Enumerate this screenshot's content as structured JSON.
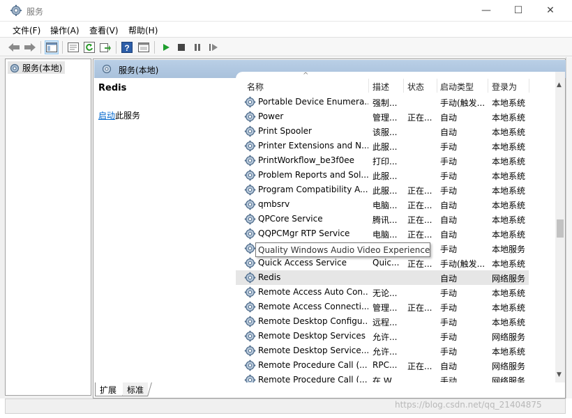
{
  "window": {
    "title": "服务",
    "min_glyph": "—",
    "max_glyph": "☐",
    "close_glyph": "✕"
  },
  "menu": [
    {
      "label": "文件(F)"
    },
    {
      "label": "操作(A)"
    },
    {
      "label": "查看(V)"
    },
    {
      "label": "帮助(H)"
    }
  ],
  "toolbar": {
    "icons": [
      "back-arrow-icon",
      "forward-arrow-icon",
      "show-tree-icon",
      "properties-icon",
      "refresh-icon",
      "export-icon",
      "help-icon",
      "console-icon",
      "start-service-icon",
      "stop-service-icon",
      "pause-service-icon",
      "restart-service-icon"
    ]
  },
  "tree": {
    "root_label": "服务(本地)"
  },
  "main": {
    "header_title": "服务(本地)"
  },
  "detail": {
    "service_name": "Redis",
    "start_link": "启动",
    "start_suffix": "此服务"
  },
  "columns": {
    "name": "名称",
    "desc": "描述",
    "state": "状态",
    "start_type": "启动类型",
    "logon": "登录为"
  },
  "services": [
    {
      "name": "Portable Device Enumera...",
      "desc": "强制...",
      "state": "",
      "start": "手动(触发...",
      "logon": "本地系统"
    },
    {
      "name": "Power",
      "desc": "管理...",
      "state": "正在...",
      "start": "自动",
      "logon": "本地系统"
    },
    {
      "name": "Print Spooler",
      "desc": "该服...",
      "state": "",
      "start": "自动",
      "logon": "本地系统"
    },
    {
      "name": "Printer Extensions and N...",
      "desc": "此服...",
      "state": "",
      "start": "手动",
      "logon": "本地系统"
    },
    {
      "name": "PrintWorkflow_be3f0ee",
      "desc": "打印...",
      "state": "",
      "start": "手动",
      "logon": "本地系统"
    },
    {
      "name": "Problem Reports and Sol...",
      "desc": "此服...",
      "state": "",
      "start": "手动",
      "logon": "本地系统"
    },
    {
      "name": "Program Compatibility A...",
      "desc": "此服...",
      "state": "正在...",
      "start": "手动",
      "logon": "本地系统"
    },
    {
      "name": "qmbsrv",
      "desc": "电脑...",
      "state": "正在...",
      "start": "自动",
      "logon": "本地系统"
    },
    {
      "name": "QPCore Service",
      "desc": "腾讯...",
      "state": "正在...",
      "start": "自动",
      "logon": "本地系统"
    },
    {
      "name": "QQPCMgr RTP Service",
      "desc": "电脑...",
      "state": "正在...",
      "start": "自动",
      "logon": "本地系统"
    },
    {
      "name": "Quality Windows Audio Video Experience",
      "desc": "",
      "state": "",
      "start": "手动",
      "logon": "本地服务"
    },
    {
      "name": "Quick Access Service",
      "desc": "Quic...",
      "state": "正在...",
      "start": "手动(触发...",
      "logon": "本地系统"
    },
    {
      "name": "Redis",
      "desc": "",
      "state": "",
      "start": "自动",
      "logon": "网络服务"
    },
    {
      "name": "Remote Access Auto Con...",
      "desc": "无论...",
      "state": "",
      "start": "手动",
      "logon": "本地系统"
    },
    {
      "name": "Remote Access Connecti...",
      "desc": "管理...",
      "state": "正在...",
      "start": "手动",
      "logon": "本地系统"
    },
    {
      "name": "Remote Desktop Configu...",
      "desc": "远程...",
      "state": "",
      "start": "手动",
      "logon": "本地系统"
    },
    {
      "name": "Remote Desktop Services",
      "desc": "允许...",
      "state": "",
      "start": "手动",
      "logon": "网络服务"
    },
    {
      "name": "Remote Desktop Service...",
      "desc": "允许...",
      "state": "",
      "start": "手动",
      "logon": "本地系统"
    },
    {
      "name": "Remote Procedure Call (...",
      "desc": "RPC...",
      "state": "正在...",
      "start": "自动",
      "logon": "网络服务"
    },
    {
      "name": "Remote Procedure Call (...",
      "desc": "在 W...",
      "state": "",
      "start": "手动",
      "logon": "网络服务"
    }
  ],
  "selected_service": "Redis",
  "tooltip": "Quality Windows Audio Video Experience",
  "tabs": [
    {
      "label": "扩展"
    },
    {
      "label": "标准"
    }
  ],
  "watermark": "https://blog.csdn.net/qq_21404875",
  "colors": {
    "header_blue": "#b9cfe6",
    "link": "#0066cc",
    "selected_row": "#e6e6e6"
  }
}
